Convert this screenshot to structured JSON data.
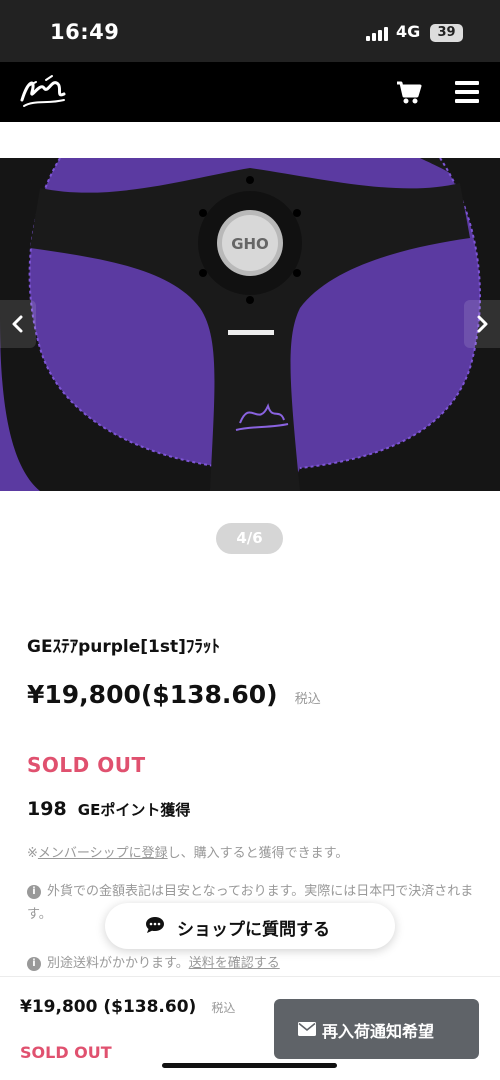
{
  "status_bar": {
    "time": "16:49",
    "network": "4G",
    "battery": "39"
  },
  "header": {
    "logo": "logo",
    "cart_icon": "cart-icon",
    "menu_icon": "hamburger-menu-icon"
  },
  "product": {
    "image_pager": "4/6",
    "title": "GEｽﾃｱpurple[1st]ﾌﾗｯﾄ",
    "price": "¥19,800($138.60)",
    "tax_label": "税込",
    "stock_status": "SOLD OUT",
    "points_value": "198",
    "points_label": "GEポイント獲得",
    "member_note_prefix": "※",
    "member_note_link": "メンバーシップに登録",
    "member_note_suffix": "し、購入すると獲得できます。",
    "currency_note": "外貨での金額表記は目安となっております。実際には日本円で決済されます。",
    "shipping_note": "別途送料がかかります。",
    "shipping_link": "送料を確認する"
  },
  "contact_button": {
    "label": "ショップに質問する"
  },
  "bottom_bar": {
    "price": "¥19,800 ($138.60)",
    "tax_label": "税込",
    "stock_status": "SOLD OUT",
    "restock_button": "再入荷通知希望"
  },
  "colors": {
    "sold_out": "#e0516f",
    "header": "#000000",
    "image_bg": "#5b3aa1",
    "restock_button": "#5f6368"
  }
}
